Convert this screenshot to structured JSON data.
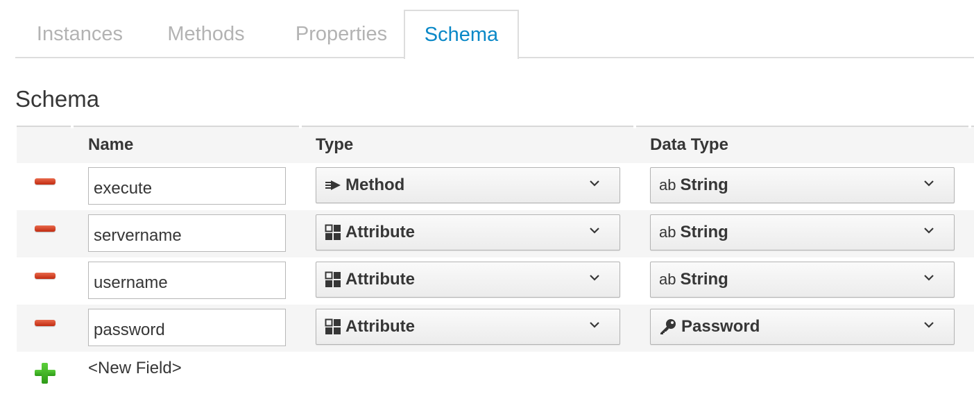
{
  "tabs": [
    {
      "label": "Instances",
      "active": false
    },
    {
      "label": "Methods",
      "active": false
    },
    {
      "label": "Properties",
      "active": false
    },
    {
      "label": "Schema",
      "active": true
    }
  ],
  "section_title": "Schema",
  "table": {
    "headers": {
      "name": "Name",
      "type": "Type",
      "data_type": "Data Type"
    },
    "rows": [
      {
        "name": "execute",
        "type": "Method",
        "type_icon": "method-icon",
        "data_type_prefix": "ab",
        "data_type": "String",
        "data_type_icon": "string-icon"
      },
      {
        "name": "servername",
        "type": "Attribute",
        "type_icon": "attribute-icon",
        "data_type_prefix": "ab",
        "data_type": "String",
        "data_type_icon": "string-icon"
      },
      {
        "name": "username",
        "type": "Attribute",
        "type_icon": "attribute-icon",
        "data_type_prefix": "ab",
        "data_type": "String",
        "data_type_icon": "string-icon"
      },
      {
        "name": "password",
        "type": "Attribute",
        "type_icon": "attribute-icon",
        "data_type_prefix": "",
        "data_type": "Password",
        "data_type_icon": "key-icon"
      }
    ],
    "new_field_label": "<New Field>"
  },
  "colors": {
    "active_tab": "#0a88c7",
    "inactive_tab": "#b3b3b3",
    "remove_button": "#d0391c",
    "add_button": "#3aa920",
    "alt_row_bg": "#f5f5f5"
  }
}
